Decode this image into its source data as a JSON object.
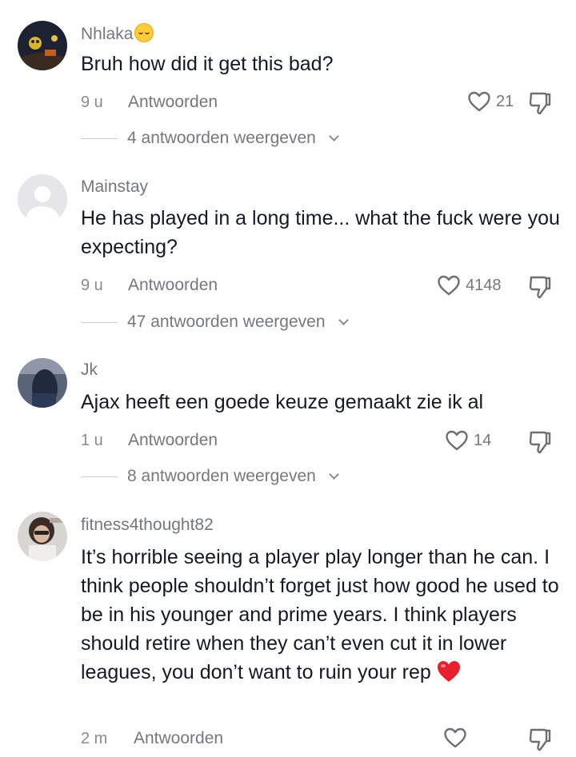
{
  "comments": [
    {
      "username": "Nhlaka",
      "has_emoji": true,
      "text": "Bruh how did it get this bad?",
      "time": "9 u",
      "reply_label": "Antwoorden",
      "likes": "21",
      "replies_label": "4 antwoorden weergeven"
    },
    {
      "username": "Mainstay",
      "text": "He has played in a long time... what the fuck were you expecting?",
      "time": "9 u",
      "reply_label": "Antwoorden",
      "likes": "4148",
      "replies_label": "47 antwoorden weergeven"
    },
    {
      "username": "Jk",
      "text": "Ajax heeft een goede keuze gemaakt zie ik al",
      "time": "1 u",
      "reply_label": "Antwoorden",
      "likes": "14",
      "replies_label": "8 antwoorden weergeven"
    },
    {
      "username": "fitness4thought82",
      "text": "It’s horrible seeing a player play longer than he can. I think people shouldn’t forget just how good he used to be in his younger and prime years. I think players should retire when they can’t even cut it in lower leagues, you don’t want to ruin your rep",
      "time": "2 m",
      "reply_label": "Antwoorden",
      "likes": ""
    }
  ],
  "icons": {
    "like": "heart-outline-icon",
    "dislike": "thumbs-down-icon",
    "expand": "chevron-down-icon",
    "text_emoji": "red-heart-emoji"
  },
  "colors": {
    "text": "#161823",
    "secondary": "#76777c",
    "heart_emoji": "#e8202e"
  }
}
